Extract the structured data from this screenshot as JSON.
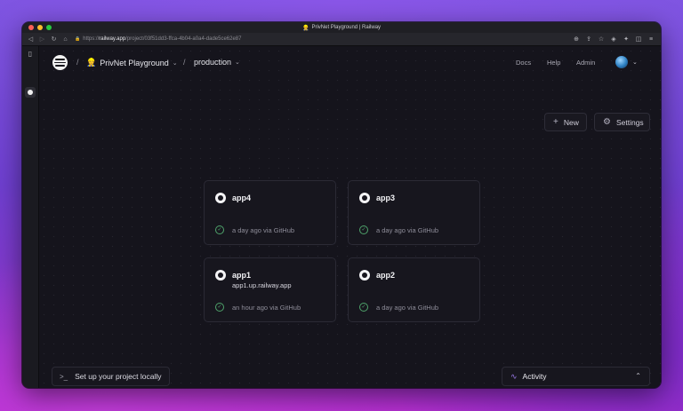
{
  "browser": {
    "window_title": "PrivNet Playground | Railway",
    "title_emoji": "👷",
    "url_prefix": "https://",
    "url_host": "railway.app",
    "url_path": "/project/03f51dd3-ffca-4b04-a0a4-dade5ce62e87"
  },
  "header": {
    "project_name": "PrivNet Playground",
    "project_emoji": "👷",
    "environment": "production",
    "nav": [
      "Docs",
      "Help",
      "Admin"
    ]
  },
  "actions": {
    "new_label": "New",
    "settings_label": "Settings"
  },
  "services": [
    {
      "name": "app4",
      "domain": "",
      "status": "a day ago via GitHub"
    },
    {
      "name": "app3",
      "domain": "",
      "status": "a day ago via GitHub"
    },
    {
      "name": "app1",
      "domain": "app1.up.railway.app",
      "status": "an hour ago via GitHub"
    },
    {
      "name": "app2",
      "domain": "",
      "status": "a day ago via GitHub"
    }
  ],
  "footer": {
    "setup_label": "Set up your project locally",
    "activity_label": "Activity"
  },
  "colors": {
    "canvas_bg": "#15141c",
    "success": "#4fa36b",
    "activity_accent": "#9b7be8"
  }
}
